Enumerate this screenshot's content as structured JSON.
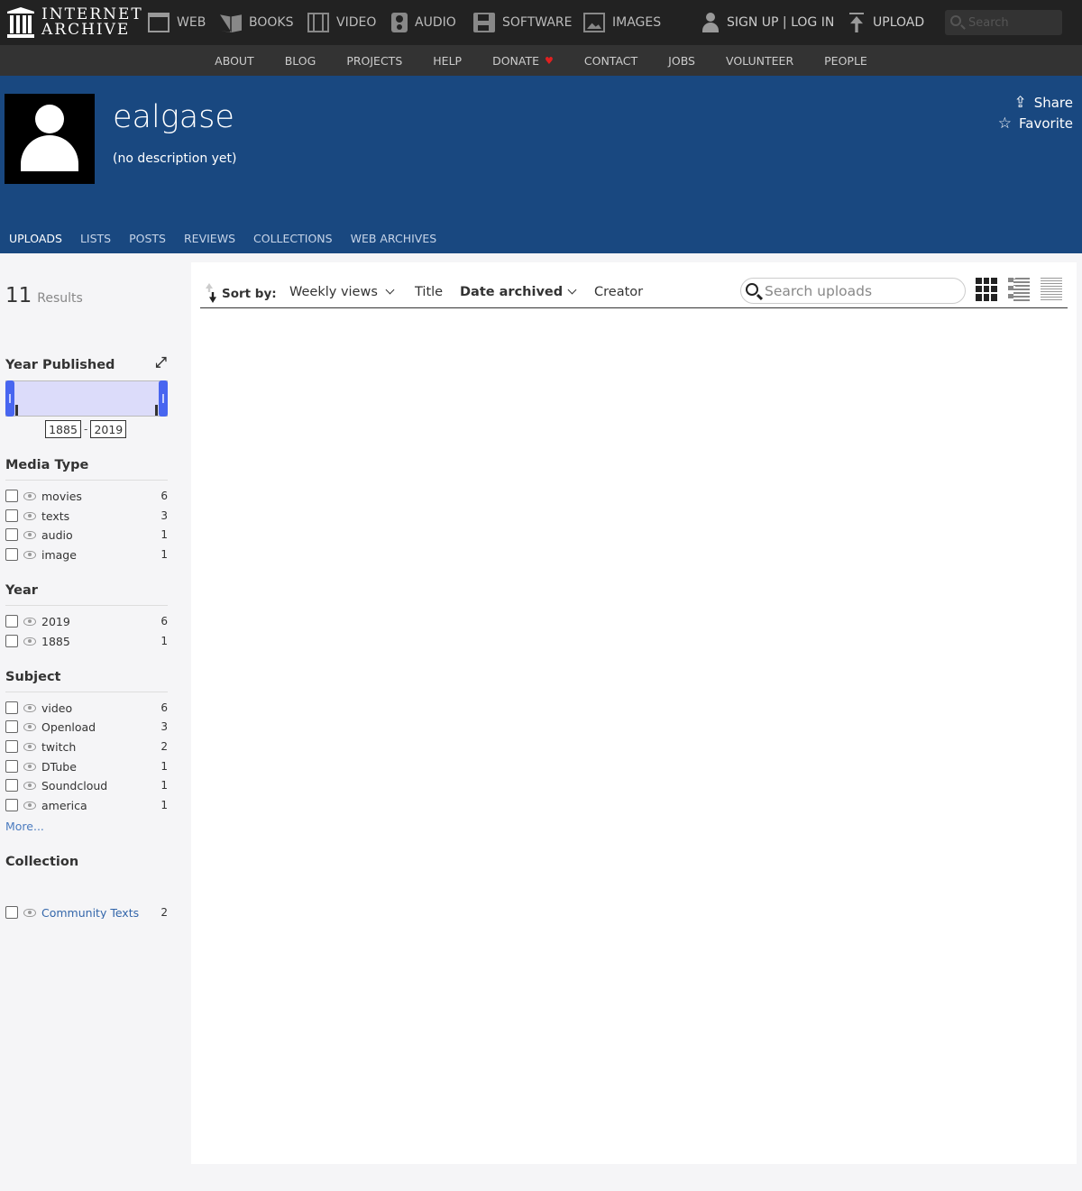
{
  "topbar": {
    "logo_line1": "INTERNET",
    "logo_line2": "ARCHIVE",
    "nav": [
      {
        "label": "WEB",
        "icon": "web-icon"
      },
      {
        "label": "BOOKS",
        "icon": "books-icon"
      },
      {
        "label": "VIDEO",
        "icon": "video-icon"
      },
      {
        "label": "AUDIO",
        "icon": "audio-icon"
      },
      {
        "label": "SOFTWARE",
        "icon": "software-icon"
      },
      {
        "label": "IMAGES",
        "icon": "images-icon"
      }
    ],
    "signin_label": "SIGN UP | LOG IN",
    "upload_label": "UPLOAD",
    "search_placeholder": "Search"
  },
  "subnav": [
    "ABOUT",
    "BLOG",
    "PROJECTS",
    "HELP",
    "DONATE",
    "CONTACT",
    "JOBS",
    "VOLUNTEER",
    "PEOPLE"
  ],
  "profile": {
    "username": "ealgase",
    "description": "(no description yet)",
    "share_label": "Share",
    "favorite_label": "Favorite",
    "tabs": [
      "UPLOADS",
      "LISTS",
      "POSTS",
      "REVIEWS",
      "COLLECTIONS",
      "WEB ARCHIVES"
    ],
    "active_tab": "UPLOADS"
  },
  "results": {
    "count": "11",
    "label": "Results"
  },
  "year_published": {
    "title": "Year Published",
    "from": "1885",
    "to": "2019"
  },
  "facets": {
    "media_type": {
      "title": "Media Type",
      "items": [
        {
          "label": "movies",
          "count": "6"
        },
        {
          "label": "texts",
          "count": "3"
        },
        {
          "label": "audio",
          "count": "1"
        },
        {
          "label": "image",
          "count": "1"
        }
      ]
    },
    "year": {
      "title": "Year",
      "items": [
        {
          "label": "2019",
          "count": "6"
        },
        {
          "label": "1885",
          "count": "1"
        }
      ]
    },
    "subject": {
      "title": "Subject",
      "items": [
        {
          "label": "video",
          "count": "6"
        },
        {
          "label": "Openload",
          "count": "3"
        },
        {
          "label": "twitch",
          "count": "2"
        },
        {
          "label": "DTube",
          "count": "1"
        },
        {
          "label": "Soundcloud",
          "count": "1"
        },
        {
          "label": "america",
          "count": "1"
        }
      ],
      "more_label": "More..."
    },
    "collection": {
      "title": "Collection",
      "items": [
        {
          "label": "Community Texts",
          "count": "2"
        }
      ]
    }
  },
  "sort": {
    "label": "Sort by:",
    "options": [
      "Weekly views",
      "Title",
      "Date archived",
      "Creator"
    ],
    "active": "Date archived"
  },
  "upload_search": {
    "placeholder": "Search uploads"
  },
  "colors": {
    "banner": "#194880",
    "topbar": "#222222",
    "subnav": "#333333",
    "accent": "#4866f0",
    "donate_heart": "#e02020"
  }
}
